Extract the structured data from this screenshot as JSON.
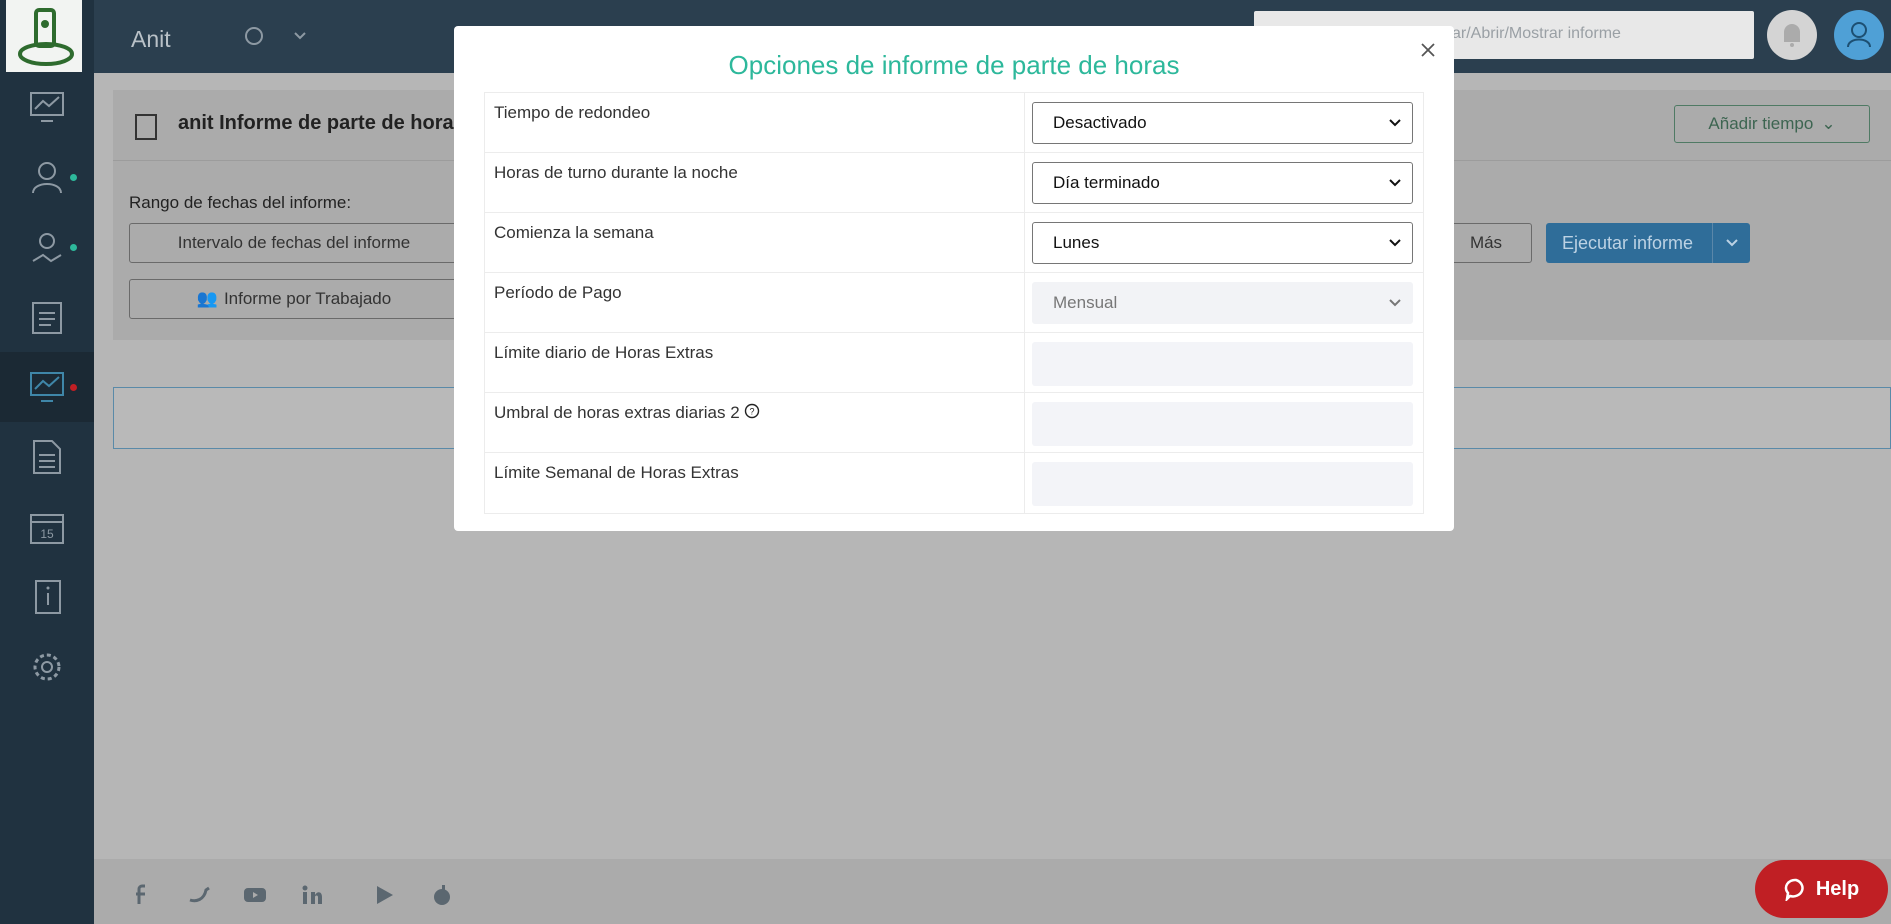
{
  "app": {
    "name": "Anit"
  },
  "search": {
    "placeholder": "ar/Abrir/Mostrar informe"
  },
  "colors": {
    "accent": "#2db89b",
    "primary": "#2f6d99",
    "help": "#c01f24"
  },
  "report": {
    "title": "anit Informe de parte de hora",
    "add_time_label": "Añadir tiempo",
    "date_range_label": "Rango de fechas del informe:",
    "date_interval_button": "Intervalo de fechas del informe",
    "by_worker_button": "Informe por Trabajado",
    "more_button": "Más",
    "run_button": "Ejecutar informe"
  },
  "help": {
    "label": "Help"
  },
  "modal": {
    "title": "Opciones de informe de parte de horas",
    "rows": [
      {
        "label": "Tiempo de redondeo",
        "type": "select",
        "value": "Desactivado"
      },
      {
        "label": "Horas de turno durante la noche",
        "type": "select",
        "value": "Día terminado"
      },
      {
        "label": "Comienza la semana",
        "type": "select",
        "value": "Lunes"
      },
      {
        "label": "Período de Pago",
        "type": "select-disabled",
        "value": "Mensual"
      },
      {
        "label": "Límite diario de Horas Extras",
        "type": "input",
        "value": ""
      },
      {
        "label": "Umbral de horas extras diarias 2",
        "type": "input",
        "value": ""
      },
      {
        "label": "Límite Semanal de Horas Extras",
        "type": "input",
        "value": ""
      }
    ]
  }
}
